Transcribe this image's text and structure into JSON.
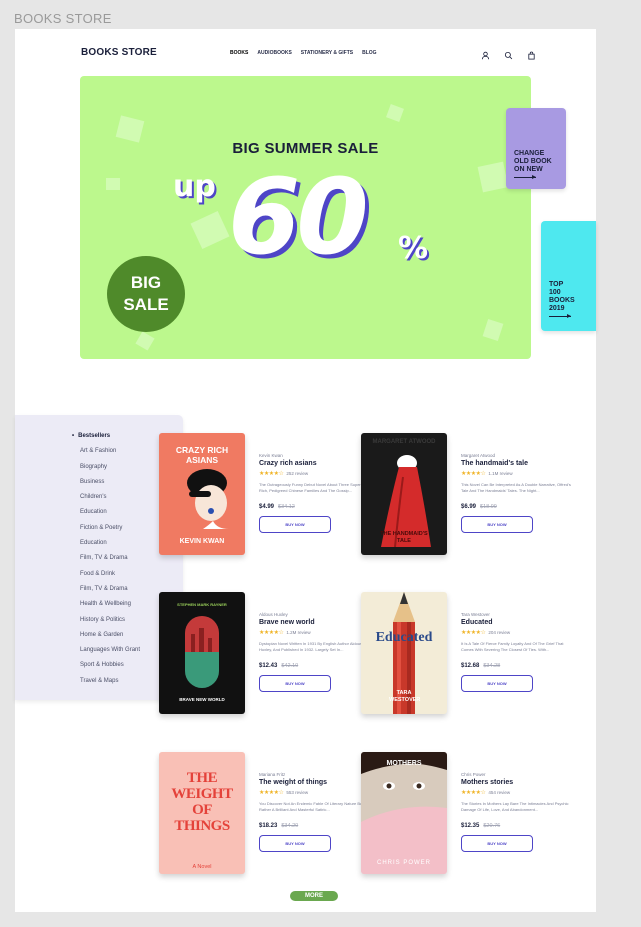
{
  "frame_title": "BOOKS STORE",
  "header": {
    "logo": "BOOKS STORE",
    "nav": [
      "BOOKS",
      "AUDIOBOOKS",
      "STATIONERY & GIFTS",
      "BLOG"
    ]
  },
  "hero": {
    "title": "BIG SUMMER SALE",
    "up": "up",
    "number": "60",
    "percent": "%",
    "badge_line1": "BIG",
    "badge_line2": "SALE"
  },
  "tabs": {
    "purple_lines": [
      "CHANGE",
      "OLD BOOK",
      "ON NEW"
    ],
    "cyan_lines": [
      "TOP",
      "100",
      "BOOKS",
      "2019"
    ]
  },
  "sidebar": {
    "items": [
      "Bestsellers",
      "Art & Fashion",
      "Biography",
      "Business",
      "Children's",
      "Education",
      "Fiction & Poetry",
      "Education",
      "Film, TV & Drama",
      "Food & Drink",
      "Film, TV & Drama",
      "Health & Wellbeing",
      "History & Politics",
      "Home & Garden",
      "Languages With Grant",
      "Sport & Hobbies",
      "Travel & Maps"
    ]
  },
  "books": [
    {
      "author": "Kevin Kwan",
      "title": "Crazy rich asians",
      "stars": "★★★★☆",
      "reviews": "252 review",
      "desc": "The Outrageously Funny Debut Novel About Three Super-Rich, Pedigreed Chinese Families And The Gossip...",
      "price": "$4.99",
      "old_price": "$34.12",
      "buy": "BUY NOW",
      "cover_title": "CRAZY RICH ASIANS",
      "cover_author": "KEVIN KWAN",
      "cover_color": "#f07a62"
    },
    {
      "author": "Margaret Atwood",
      "title": "The handmaid's tale",
      "stars": "★★★★☆",
      "reviews": "1.1M review",
      "desc": "This Novel Can Be Interpreted As A Double Narrative, Offred's Tale And The Handmaids' Tales. The Night...",
      "price": "$6.99",
      "old_price": "$18.99",
      "buy": "BUY NOW",
      "cover_title": "THE HANDMAID'S TALE",
      "cover_author": "MARGARET ATWOOD",
      "cover_color": "#1a1a1a"
    },
    {
      "author": "Aldous Huxley",
      "title": "Brave new world",
      "stars": "★★★★☆",
      "reviews": "1.2M review",
      "desc": "Dystopian Novel Written In 1931 By English Author Aldous Huxley, And Published In 1932. Largely Set In...",
      "price": "$12.43",
      "old_price": "$42.10",
      "buy": "BUY NOW",
      "cover_title": "BRAVE NEW WORLD",
      "cover_author": "STEPHEN MARK RAYNER",
      "cover_color": "#111111"
    },
    {
      "author": "Tara Westover",
      "title": "Educated",
      "stars": "★★★★☆",
      "reviews": "204 review",
      "desc": "It Is A Tale Of Fierce Family Loyalty And Of The Grief That Comes With Severing The Closest Of Ties. With...",
      "price": "$12.68",
      "old_price": "$34.28",
      "buy": "BUY NOW",
      "cover_title": "Educated",
      "cover_author": "TARA WESTOVER",
      "cover_color": "#f3ecd7"
    },
    {
      "author": "Mariana Fritz",
      "title": "The weight of things",
      "stars": "★★★★☆",
      "reviews": "553 review",
      "desc": "You Discover Not An Endemic Fable Of Literary Nature But Rather A Brilliant And Masterful Satiric...",
      "price": "$18.23",
      "old_price": "$34.20",
      "buy": "BUY NOW",
      "cover_title": "THE WEIGHT OF THINGS",
      "cover_author": "A Novel",
      "cover_color": "#f9c0b6"
    },
    {
      "author": "Chris Power",
      "title": "Mothers stories",
      "stars": "★★★★☆",
      "reviews": "454 review",
      "desc": "The Stories In Mothers Lay Bare The Intimacies And Psychic Damage Of Life, Love, And Abandonment...",
      "price": "$12.35",
      "old_price": "$20.76",
      "buy": "BUY NOW",
      "cover_title": "MOTHERS",
      "cover_author": "CHRIS POWER",
      "cover_color": "#f3bfc8"
    }
  ],
  "more_label": "MORE"
}
